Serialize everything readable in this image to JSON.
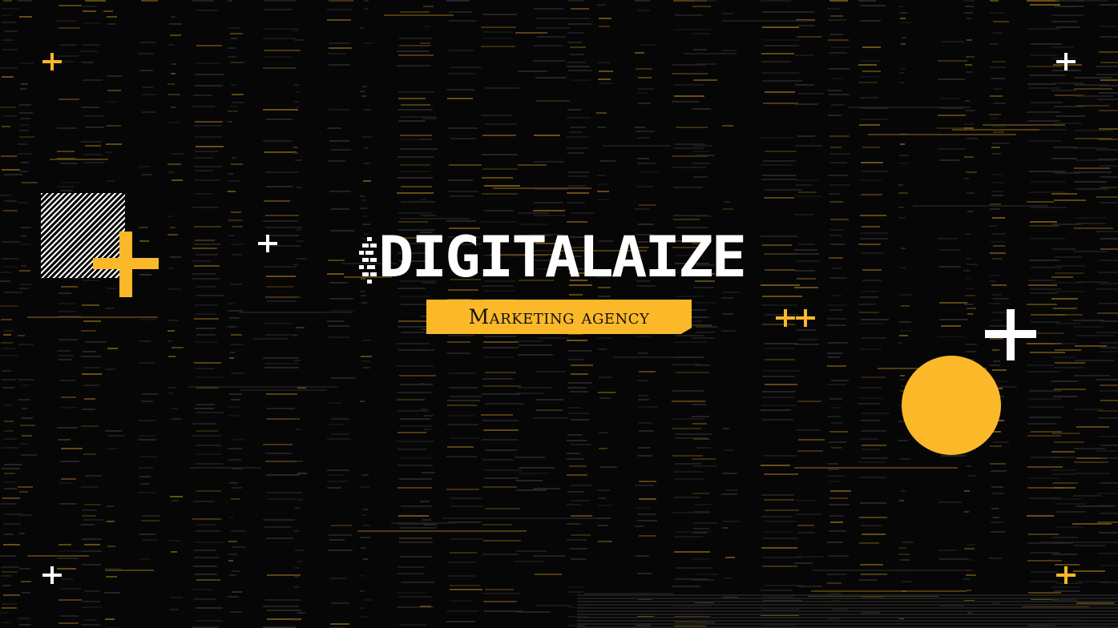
{
  "brand": {
    "name": "DIGITALAIZE",
    "tagline": "Marketing agency"
  },
  "colors": {
    "background": "#060606",
    "accent": "#fbb829",
    "foreground": "#ffffff"
  },
  "decorations": {
    "plus_icons": [
      "plus-icon",
      "plus-icon",
      "plus-icon",
      "plus-icon",
      "plus-icon",
      "plus-icon",
      "plus-icon",
      "plus-icon"
    ],
    "shapes": [
      "hatched-square",
      "yellow-circle",
      "large-plus-icon"
    ]
  }
}
